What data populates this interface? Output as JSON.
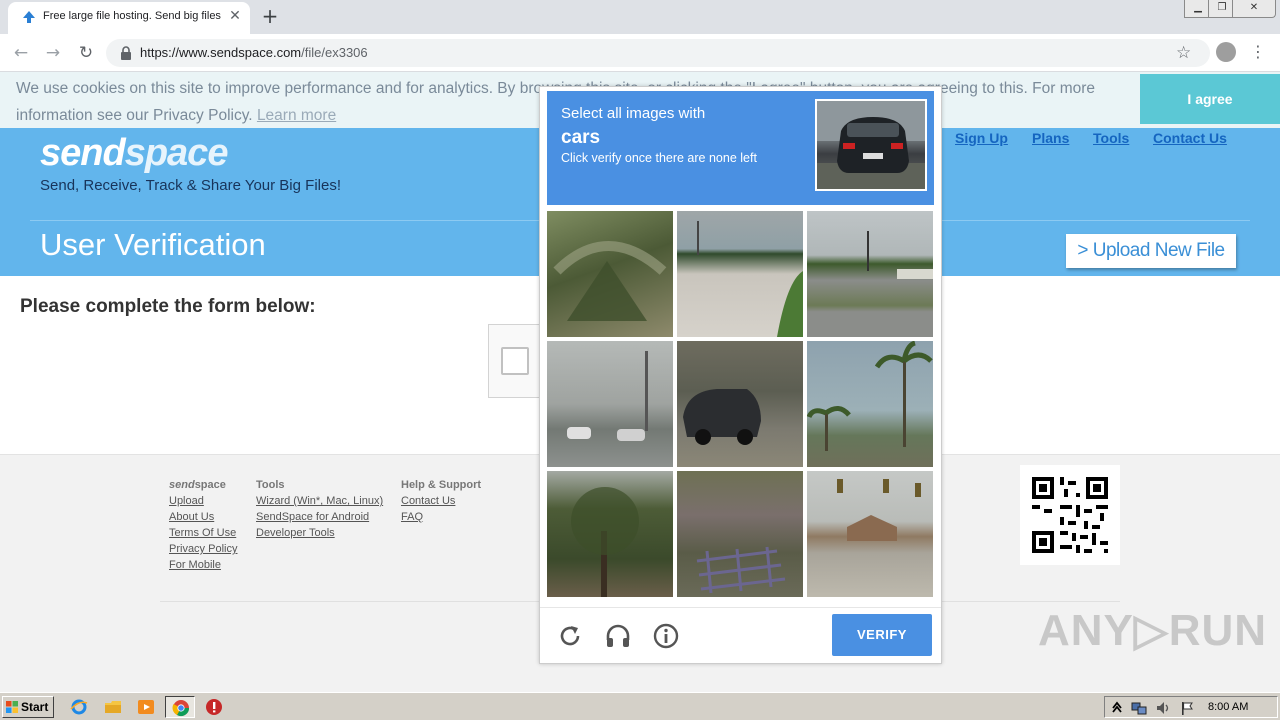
{
  "browser": {
    "tab_title": "Free large file hosting. Send big files",
    "tab_close": "✕",
    "new_tab": "+",
    "url_host": "https://www.sendspace.com",
    "url_path": "/file/ex3306",
    "window_controls": {
      "minimize": "▁",
      "maximize": "❐",
      "close": "✕"
    },
    "nav": {
      "back": "←",
      "forward": "→",
      "reload": "↻"
    },
    "star": "☆",
    "menu": "⋮"
  },
  "cookie_banner": {
    "text": "We use cookies on this site to improve performance and for analytics. By browsing this site, or clicking the \"I agree\" button, you are agreeing to this. For more information see our Privacy Policy.",
    "learn_more": "Learn more",
    "agree_label": "I agree"
  },
  "site": {
    "logo_a": "send",
    "logo_b": "space",
    "tagline": "Send, Receive, Track & Share Your Big Files!",
    "top_links": [
      "Sign Up",
      "Plans",
      "Tools",
      "Contact Us"
    ],
    "page_heading": "User Verification",
    "upload_button": "> Upload New File",
    "form_heading": "Please complete the form below:"
  },
  "captcha": {
    "line1": "Select all images with",
    "target": "cars",
    "line3": "Click verify once there are none left",
    "verify_label": "VERIFY",
    "footer_icons": [
      "reload-icon",
      "audio-headphones-icon",
      "info-icon"
    ]
  },
  "footer": {
    "col1_head_a": "send",
    "col1_head_b": "space",
    "col1": [
      "Upload",
      "About Us",
      "Terms Of Use",
      "Privacy Policy",
      "For Mobile"
    ],
    "col2_head": "Tools",
    "col2": [
      "Wizard (Win*, Mac, Linux)",
      "SendSpace for Android",
      "Developer Tools"
    ],
    "col3_head": "Help & Support",
    "col3": [
      "Contact Us",
      "FAQ"
    ],
    "watermark": "ANY▷RUN"
  },
  "taskbar": {
    "start_label": "Start",
    "clock": "8:00 AM"
  },
  "colors": {
    "captcha_blue": "#4a90e2",
    "sendspace_blue": "#62b5ec",
    "agree_teal": "#5bc8d5"
  }
}
